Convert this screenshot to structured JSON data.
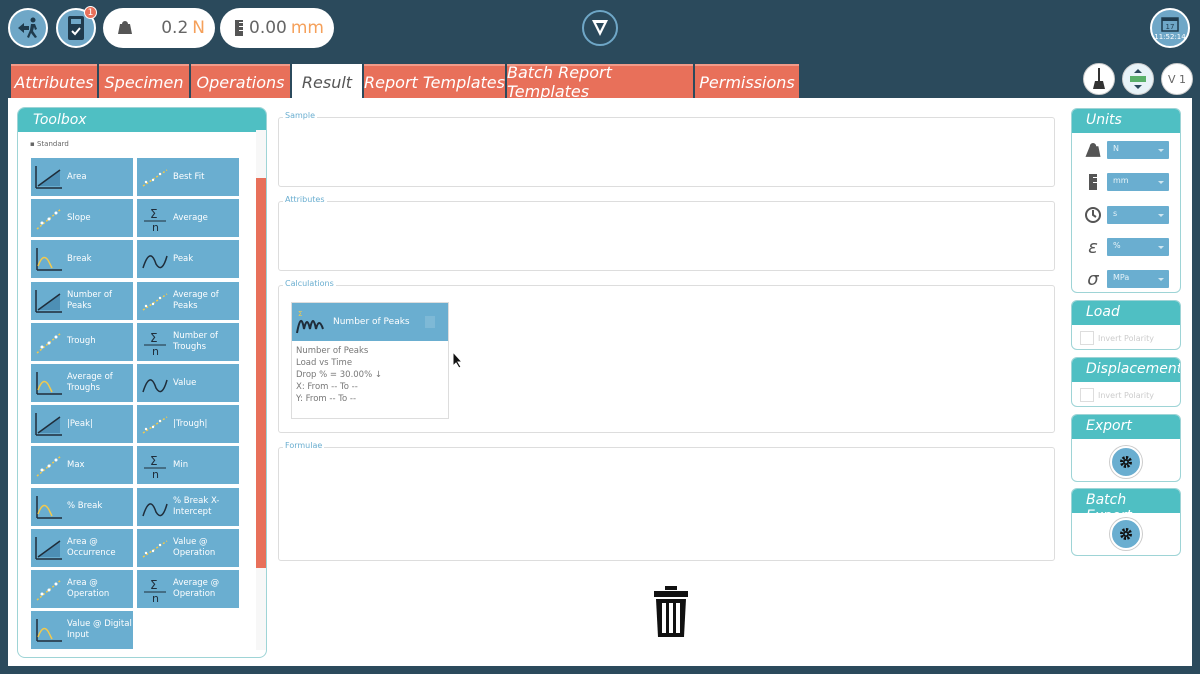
{
  "topbar": {
    "notification_count": "1",
    "load": {
      "value": "0.2",
      "unit": "N"
    },
    "displacement": {
      "value": "0.00",
      "unit": "mm"
    },
    "clock": {
      "day": "17",
      "time": "11:52:14"
    }
  },
  "tabs": [
    {
      "label": "Attributes",
      "active": false
    },
    {
      "label": "Specimen",
      "active": false
    },
    {
      "label": "Operations",
      "active": false
    },
    {
      "label": "Result",
      "active": true
    },
    {
      "label": "Report Templates",
      "active": false
    },
    {
      "label": "Batch Report Templates",
      "active": false
    },
    {
      "label": "Permissions",
      "active": false
    }
  ],
  "tool_buttons": {
    "version_label": "V 1"
  },
  "toolbox": {
    "title": "Toolbox",
    "group": "Standard",
    "items": [
      {
        "label": "Area",
        "icon": "area-chart-icon"
      },
      {
        "label": "Best Fit",
        "icon": "best-fit-icon"
      },
      {
        "label": "Slope",
        "icon": "slope-icon"
      },
      {
        "label": "Average",
        "icon": "average-icon"
      },
      {
        "label": "Break",
        "icon": "break-icon"
      },
      {
        "label": "Peak",
        "icon": "peak-icon"
      },
      {
        "label": "Number of Peaks",
        "icon": "number-of-peaks-icon"
      },
      {
        "label": "Average of Peaks",
        "icon": "average-of-peaks-icon"
      },
      {
        "label": "Trough",
        "icon": "trough-icon"
      },
      {
        "label": "Number of Troughs",
        "icon": "number-of-troughs-icon"
      },
      {
        "label": "Average of Troughs",
        "icon": "average-of-troughs-icon"
      },
      {
        "label": "Value",
        "icon": "value-icon"
      },
      {
        "label": "|Peak|",
        "icon": "abs-peak-icon"
      },
      {
        "label": "|Trough|",
        "icon": "abs-trough-icon"
      },
      {
        "label": "Max",
        "icon": "max-icon"
      },
      {
        "label": "Min",
        "icon": "min-icon"
      },
      {
        "label": "% Break",
        "icon": "percent-break-icon"
      },
      {
        "label": "% Break X-Intercept",
        "icon": "percent-break-x-intercept-icon"
      },
      {
        "label": "Area @ Occurrence",
        "icon": "area-occurrence-icon"
      },
      {
        "label": "Value @ Operation",
        "icon": "value-operation-icon"
      },
      {
        "label": "Area @ Operation",
        "icon": "area-operation-icon"
      },
      {
        "label": "Average @ Operation",
        "icon": "average-operation-icon"
      },
      {
        "label": "Value @ Digital Input",
        "icon": "value-digital-input-icon"
      }
    ]
  },
  "panels": {
    "sample": "Sample",
    "attributes": "Attributes",
    "calculations": "Calculations",
    "formulae": "Formulae"
  },
  "calc_card": {
    "title": "Number of Peaks",
    "lines": [
      "Number of Peaks",
      "Load vs Time",
      "Drop % = 30.00% ↓",
      "X: From -- To --",
      "Y: From -- To --"
    ]
  },
  "units": {
    "title": "Units",
    "rows": [
      {
        "icon": "weight-icon",
        "value": "N"
      },
      {
        "icon": "ruler-icon",
        "value": "mm"
      },
      {
        "icon": "clock-icon",
        "value": "s"
      },
      {
        "icon": "strain-epsilon-icon",
        "symbol": "ε",
        "value": "%"
      },
      {
        "icon": "stress-sigma-icon",
        "symbol": "σ",
        "value": "MPa"
      }
    ]
  },
  "load": {
    "title": "Load",
    "invert_label": "Invert Polarity"
  },
  "displacement": {
    "title": "Displacement",
    "invert_label": "Invert Polarity"
  },
  "export": {
    "title": "Export"
  },
  "batch_export": {
    "title": "Batch Export"
  },
  "colors": {
    "accent": "#4fbfc3",
    "tab": "#e8705a",
    "tool": "#6aaed0",
    "topbar": "#2b4a5c"
  }
}
